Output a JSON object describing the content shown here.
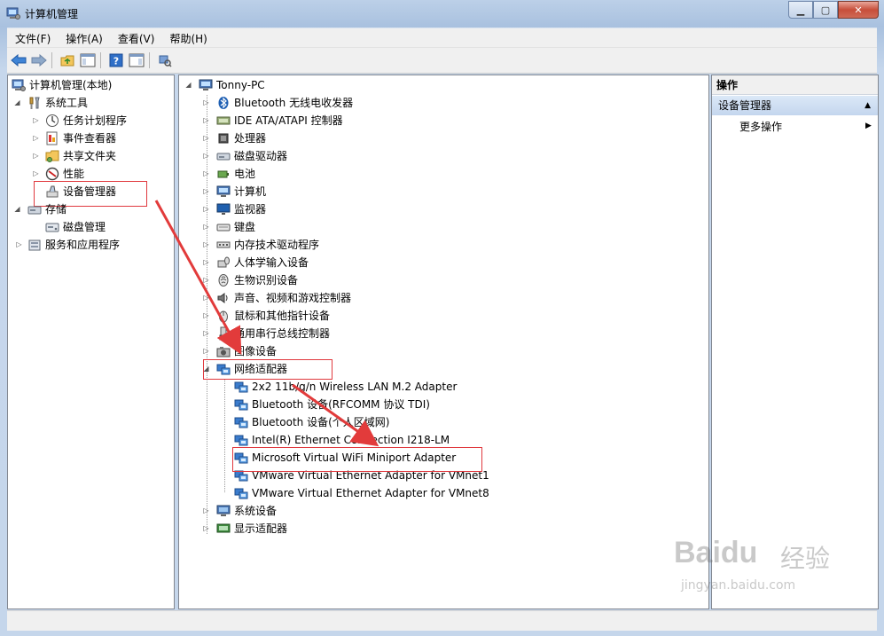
{
  "window": {
    "title": "计算机管理"
  },
  "menu": [
    "文件(F)",
    "操作(A)",
    "查看(V)",
    "帮助(H)"
  ],
  "toolbar": [
    "back-icon",
    "forward-icon",
    "up-folder-icon",
    "show-hide-tree-icon",
    "help-icon",
    "show-action-pane-icon",
    "scan-hardware-icon"
  ],
  "left_tree": {
    "root": "计算机管理(本地)",
    "system_tools": "系统工具",
    "task_scheduler": "任务计划程序",
    "event_viewer": "事件查看器",
    "shared_folders": "共享文件夹",
    "performance": "性能",
    "device_manager": "设备管理器",
    "storage": "存储",
    "disk_management": "磁盘管理",
    "services_apps": "服务和应用程序"
  },
  "device_tree": {
    "root": "Tonny-PC",
    "categories": [
      "Bluetooth 无线电收发器",
      "IDE ATA/ATAPI 控制器",
      "处理器",
      "磁盘驱动器",
      "电池",
      "计算机",
      "监视器",
      "键盘",
      "内存技术驱动程序",
      "人体学输入设备",
      "生物识别设备",
      "声音、视频和游戏控制器",
      "鼠标和其他指针设备",
      "通用串行总线控制器",
      "图像设备",
      "网络适配器"
    ],
    "network_adapters": [
      "2x2 11b/g/n Wireless LAN M.2 Adapter",
      "Bluetooth 设备(RFCOMM 协议 TDI)",
      "Bluetooth 设备(个人区域网)",
      "Intel(R) Ethernet Connection I218-LM",
      "Microsoft Virtual WiFi Miniport Adapter",
      "VMware Virtual Ethernet Adapter for VMnet1",
      "VMware Virtual Ethernet Adapter for VMnet8"
    ],
    "after": [
      "系统设备",
      "显示适配器"
    ]
  },
  "actions": {
    "header": "操作",
    "section": "设备管理器",
    "more": "更多操作"
  },
  "watermark": {
    "brand": "Baidu",
    "cn": "经验",
    "url": "jingyan.baidu.com"
  },
  "colors": {
    "highlight_box": "#e0393e",
    "arrow": "#e23b3b",
    "window_frame": "#bcd0e8"
  }
}
